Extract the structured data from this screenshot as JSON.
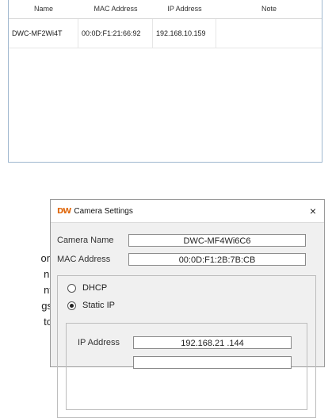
{
  "device_list": {
    "columns": [
      "Name",
      "MAC Address",
      "IP Address",
      "Note"
    ],
    "rows": [
      {
        "name": "DWC-MF2Wi4T",
        "mac": "00:0D:F1:21:66:92",
        "ip": "192.168.10.159",
        "note": ""
      }
    ]
  },
  "doc_fragments": [
    "on",
    "n.",
    "nt",
    "gs",
    "to"
  ],
  "dialog": {
    "logo": "DW",
    "title": "Camera Settings",
    "close_glyph": "×",
    "camera_name_label": "Camera Name",
    "camera_name_value": "DWC-MF4Wi6C6",
    "mac_label": "MAC Address",
    "mac_value": "00:0D:F1:2B:7B:CB",
    "dhcp_label": "DHCP",
    "static_ip_label": "Static IP",
    "ip_label": "IP Address",
    "ip_value": "192.168.21 .144",
    "selected_mode": "Static IP"
  },
  "colors": {
    "logo": "#e06a10",
    "window_border": "#9fb7cf"
  }
}
